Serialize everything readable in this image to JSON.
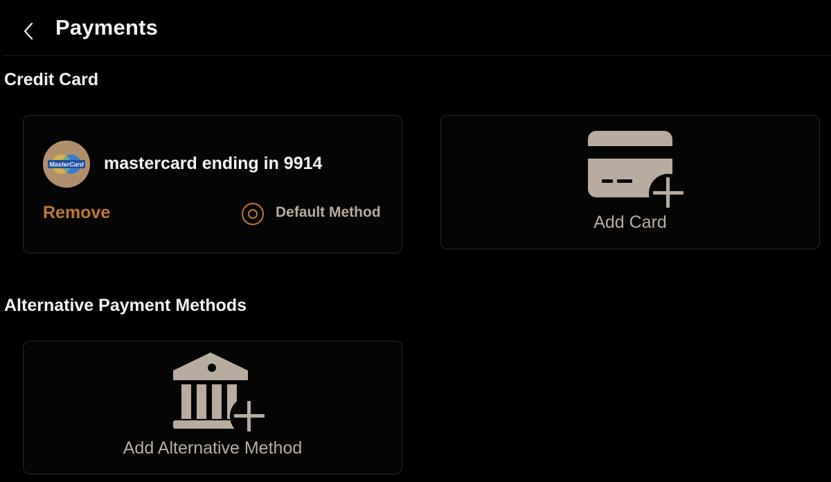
{
  "header": {
    "title": "Payments",
    "back_icon": "chevron-left-icon"
  },
  "credit_card_section": {
    "title": "Credit Card",
    "existing_card": {
      "brand_logo_text": "MasterCard",
      "name": "mastercard ending in 9914",
      "remove_label": "Remove",
      "default_label": "Default Method",
      "default_selected": true
    },
    "add_card": {
      "label": "Add Card",
      "icon": "credit-card-add-icon"
    }
  },
  "alternative_section": {
    "title": "Alternative Payment Methods",
    "add_alternative": {
      "label": "Add Alternative Method",
      "icon": "bank-add-icon"
    }
  },
  "colors": {
    "background": "#000000",
    "accent": "#c0782e",
    "icon_tint": "#b8aca0",
    "card_border": "#2a2a2a",
    "logo_bg": "#b28f6c"
  }
}
